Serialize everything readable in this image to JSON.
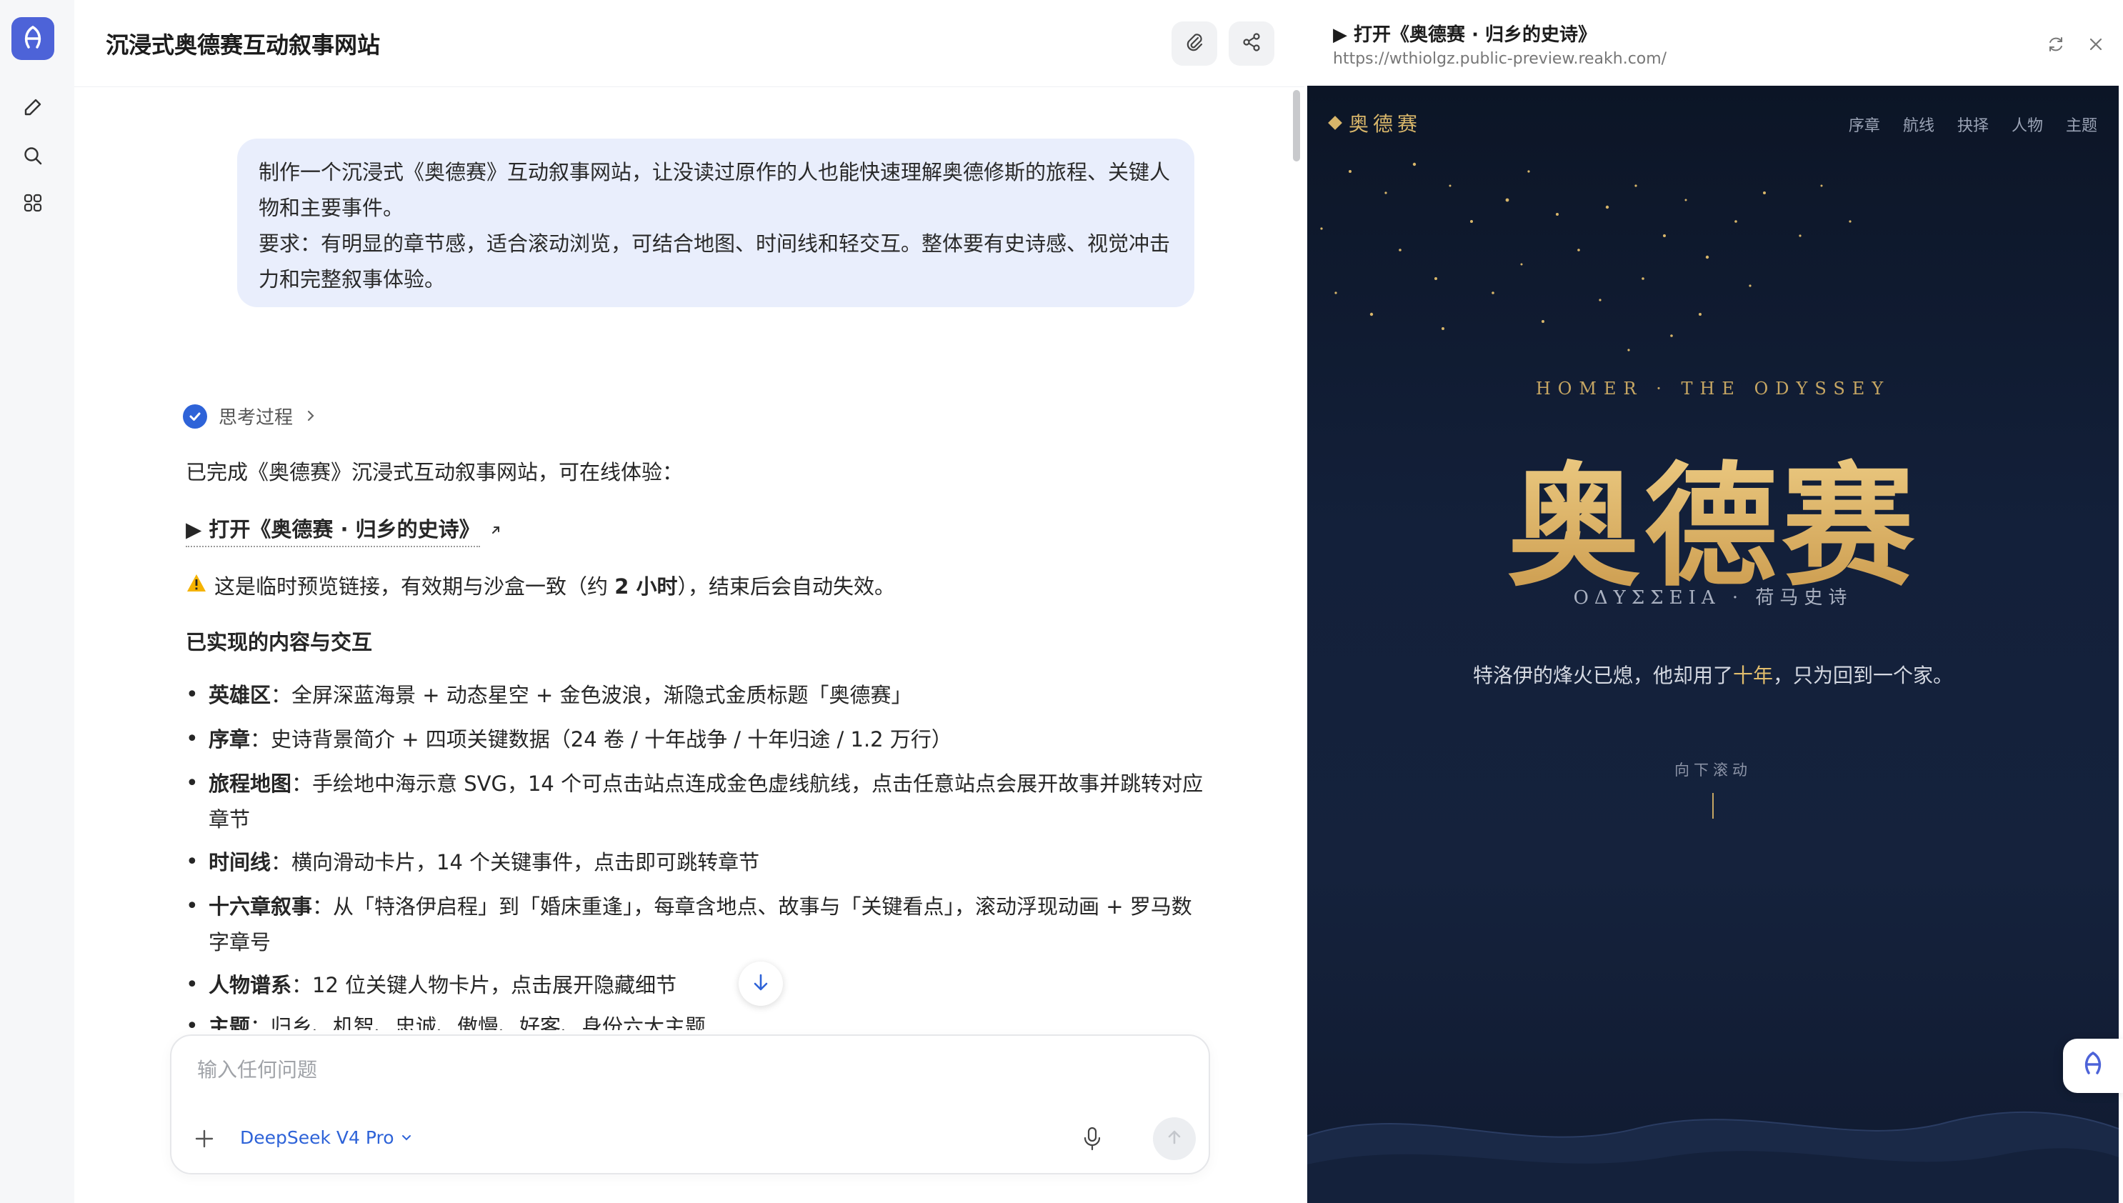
{
  "chat": {
    "title": "沉浸式奥德赛互动叙事网站",
    "user_message_line1": "制作一个沉浸式《奥德赛》互动叙事网站，让没读过原作的人也能快速理解奥德修斯的旅程、关键人",
    "user_message_line2": "物和主要事件。",
    "user_message_line3": "要求：有明显的章节感，适合滚动浏览，可结合地图、时间线和轻交互。整体要有史诗感、视觉冲击",
    "user_message_line4": "力和完整叙事体验。",
    "thinking_label": "思考过程",
    "answer_intro": "已完成《奥德赛》沉浸式互动叙事网站，可在线体验：",
    "answer_link": "▶ 打开《奥德赛 · 归乡的史诗》",
    "warning_pre": "这是临时预览链接，有效期与沙盒一致（约 ",
    "warning_bold": "2 小时",
    "warning_post": "），结束后会自动失效。",
    "section_heading": "已实现的内容与交互",
    "bullets": [
      {
        "title": "英雄区",
        "text": "：全屏深蓝海景 + 动态星空 + 金色波浪，渐隐式金质标题「奥德赛」"
      },
      {
        "title": "序章",
        "text": "：史诗背景简介 + 四项关键数据（24 卷 / 十年战争 / 十年归途 / 1.2 万行）"
      },
      {
        "title": "旅程地图",
        "text": "：手绘地中海示意 SVG，14 个可点击站点连成金色虚线航线，点击任意站点会展开故事并跳转对应",
        "text2": "章节"
      },
      {
        "title": "时间线",
        "text": "：横向滑动卡片，14 个关键事件，点击即可跳转章节"
      },
      {
        "title": "十六章叙事",
        "text": "：从「特洛伊启程」到「婚床重逢」，每章含地点、故事与「关键看点」，滚动浮现动画 + 罗马数",
        "text2": "字章号"
      },
      {
        "title": "人物谱系",
        "text": "：12 位关键人物卡片，点击展开隐藏细节"
      },
      {
        "title": "主题",
        "text": "：归乡、机智、忠诚、傲慢、好客、身份六大主题"
      }
    ]
  },
  "input": {
    "placeholder": "输入任何问题",
    "model": "DeepSeek V4 Pro"
  },
  "preview": {
    "title": "▶ 打开《奥德赛 · 归乡的史诗》",
    "url": "https://wthiolgz.public-preview.reakh.com/",
    "site": {
      "brand": "奥德赛",
      "nav": [
        "序章",
        "航线",
        "抉择",
        "人物",
        "主题"
      ],
      "kicker": "HOMER · THE ODYSSEY",
      "hero_title": "奥德赛",
      "subtitle": "ΟΔΥΣΣΕΙΑ · 荷马史诗",
      "tagline_pre": "特洛伊的烽火已熄，他却用了",
      "tagline_hl": "十年",
      "tagline_post": "，只为回到一个家。",
      "scroll_hint": "向下滚动"
    }
  },
  "colors": {
    "accent_blue": "#2e63d8",
    "bubble_bg": "#e9eefc",
    "site_gold": "#d8b66a",
    "site_bg": "#13203a"
  },
  "icons": [
    "app-logo-icon",
    "edit-icon",
    "search-icon",
    "apps-icon",
    "attach-icon",
    "share-icon",
    "check-icon",
    "chevron-right-icon",
    "external-link-icon",
    "warning-icon",
    "arrow-down-icon",
    "plus-icon",
    "chevron-down-icon",
    "mic-icon",
    "send-icon",
    "refresh-icon",
    "close-icon"
  ]
}
